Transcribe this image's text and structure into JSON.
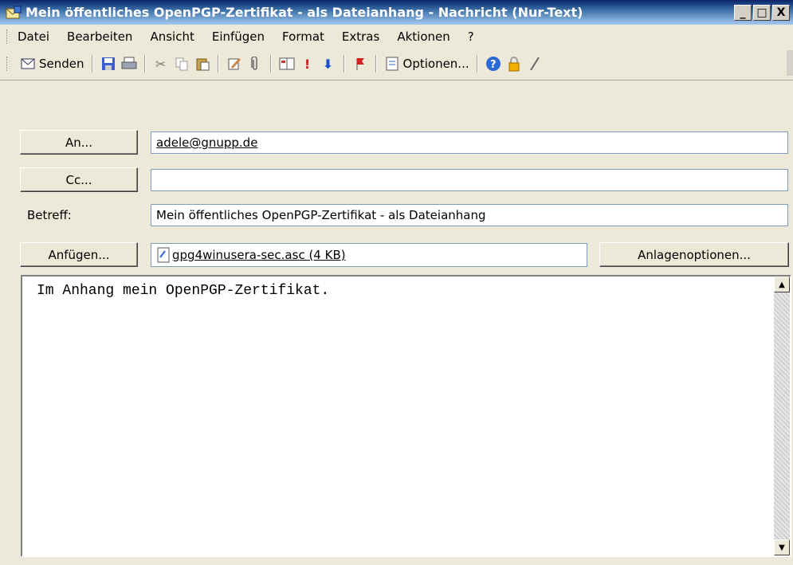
{
  "window": {
    "title": "Mein öffentliches OpenPGP-Zertifikat - als Dateianhang - Nachricht (Nur-Text)",
    "minimize": "_",
    "maximize": "□",
    "close": "X"
  },
  "menu": [
    "Datei",
    "Bearbeiten",
    "Ansicht",
    "Einfügen",
    "Format",
    "Extras",
    "Aktionen",
    "?"
  ],
  "toolbar": {
    "send_label": "Senden",
    "options_label": "Optionen..."
  },
  "form": {
    "to_button": "An...",
    "to_value": "adele@gnupp.de",
    "cc_button": "Cc...",
    "cc_value": "",
    "subject_label": "Betreff:",
    "subject_value": "Mein öffentliches OpenPGP-Zertifikat - als Dateianhang",
    "attach_button": "Anfügen...",
    "attachment": "gpg4winusera-sec.asc (4 KB)",
    "attach_options_button": "Anlagenoptionen..."
  },
  "message_body": "Im Anhang mein OpenPGP-Zertifikat.",
  "icons": [
    "envelope-icon",
    "save-icon",
    "print-icon",
    "cut-icon",
    "copy-icon",
    "paste-icon",
    "edit-icon",
    "paperclip-icon",
    "addressbook-icon",
    "high-importance-icon",
    "low-importance-icon",
    "flag-icon",
    "options-icon",
    "help-icon",
    "lock-icon",
    "signature-icon"
  ]
}
